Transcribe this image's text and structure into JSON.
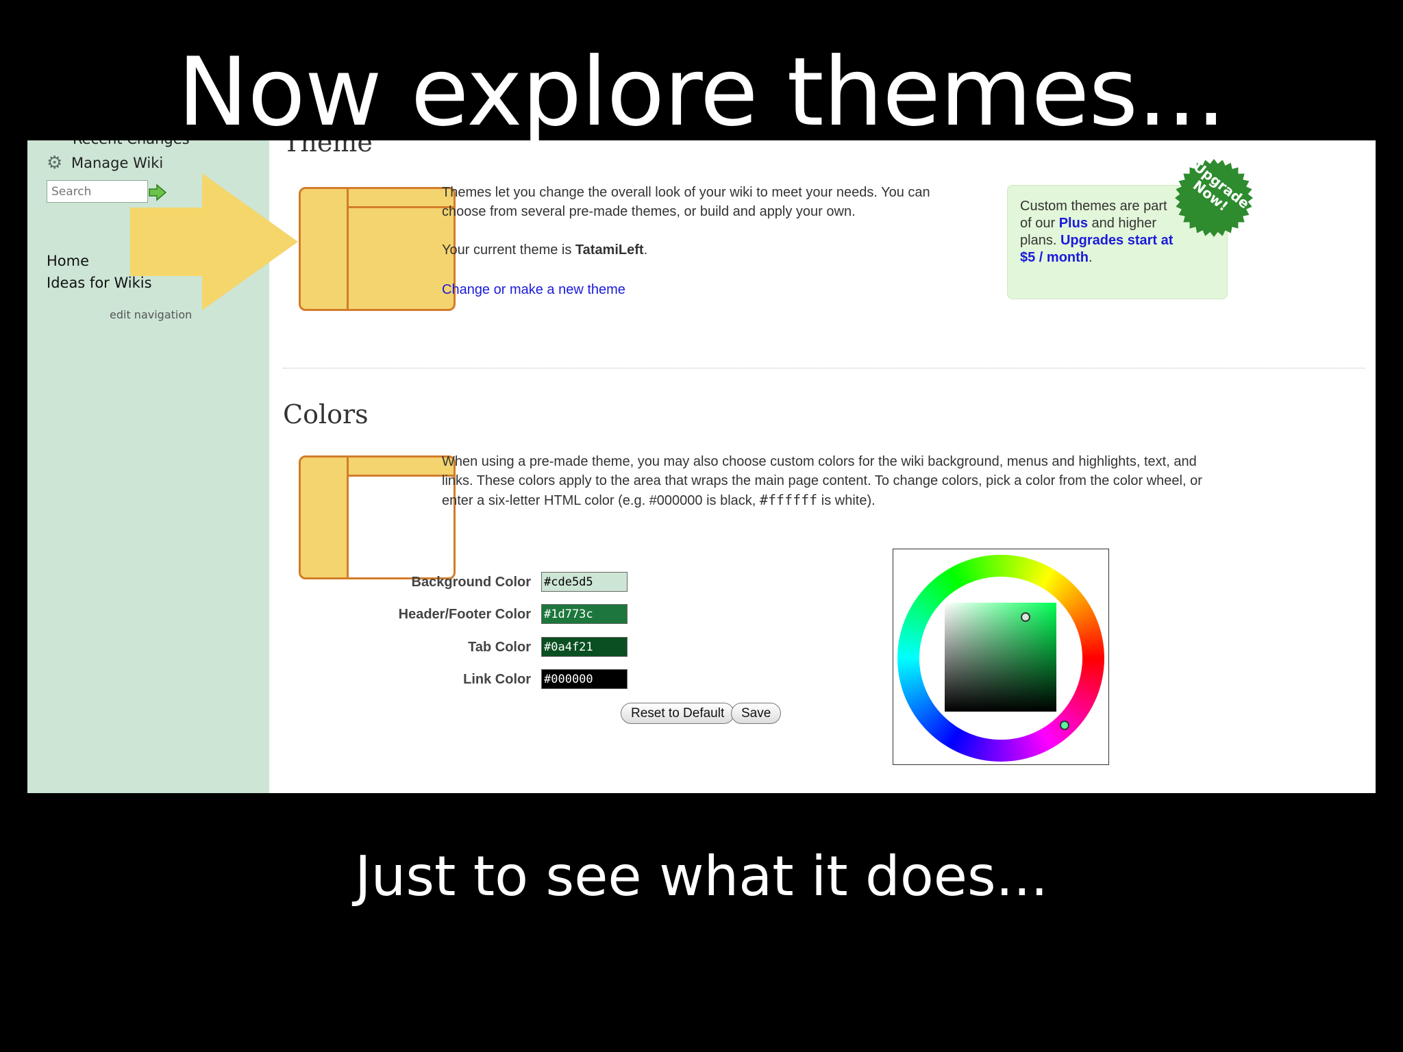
{
  "slide": {
    "title": "Now explore themes...",
    "subtitle": "Just to see what it does..."
  },
  "sidebar": {
    "cut_item": "Recent Changes",
    "manage_wiki": "Manage Wiki",
    "search_placeholder": "Search",
    "nav": [
      "Home",
      "Ideas for Wikis"
    ],
    "edit_navigation": "edit navigation"
  },
  "theme": {
    "heading": "Theme",
    "description": "Themes let you change the overall look of your wiki to meet your needs. You can choose from several pre-made themes, or build and apply your own.",
    "current_prefix": "Your current theme is ",
    "current_name": "TatamiLeft",
    "current_suffix": ".",
    "change_link": "Change or make a new theme"
  },
  "upgrade": {
    "line1": "Custom themes are part of our ",
    "plus": "Plus",
    "line2": " and higher plans.",
    "price_link": "Upgrades start at $5 / month",
    "suffix": ".",
    "seal_text": "Upgrade Now!"
  },
  "colors": {
    "heading": "Colors",
    "description_1": "When using a pre-made theme, you may also choose custom colors for the wiki background, menus and highlights, text, and links. These colors apply to the area that wraps the main page content. To change colors, pick a color from the color wheel, or enter a six-letter HTML color (e.g. #000000 is black, ",
    "white_code": "#ffffff",
    "description_2": " is white).",
    "fields": [
      {
        "label": "Background Color",
        "value": "#cde5d5",
        "bg": "#cde5d5",
        "fg": "#000000"
      },
      {
        "label": "Header/Footer Color",
        "value": "#1d773c",
        "bg": "#1d773c",
        "fg": "#ffffff"
      },
      {
        "label": "Tab Color",
        "value": "#0a4f21",
        "bg": "#0a4f21",
        "fg": "#ffffff"
      },
      {
        "label": "Link Color",
        "value": "#000000",
        "bg": "#000000",
        "fg": "#ffffff"
      }
    ],
    "reset_label": "Reset to Default",
    "save_label": "Save"
  },
  "accents": {
    "sidebar_bg": "#cde5d5",
    "thumb_fill": "#f4d46e",
    "thumb_border": "#d37c2a",
    "link": "#1a1adb",
    "arrow": "#f5d66a",
    "seal": "#2e8b2e"
  }
}
